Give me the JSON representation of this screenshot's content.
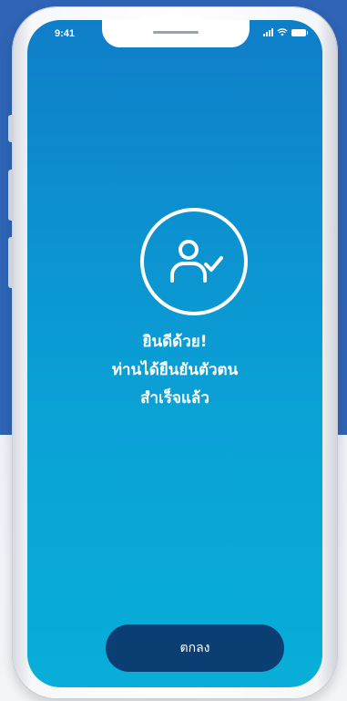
{
  "status_bar": {
    "time": "9:41"
  },
  "icons": {
    "signal": "signal-icon",
    "wifi": "wifi-icon",
    "battery": "battery-icon",
    "verified": "user-check-icon"
  },
  "message": {
    "line1": "ยินดีด้วย!",
    "line2": "ท่านได้ยืนยันตัวตน",
    "line3": "สำเร็จแล้ว"
  },
  "actions": {
    "ok_label": "ตกลง"
  },
  "colors": {
    "screen_top": "#0f7ec9",
    "screen_bottom": "#08aed8",
    "button": "#0b3f73",
    "backdrop": "#2f64b6"
  }
}
